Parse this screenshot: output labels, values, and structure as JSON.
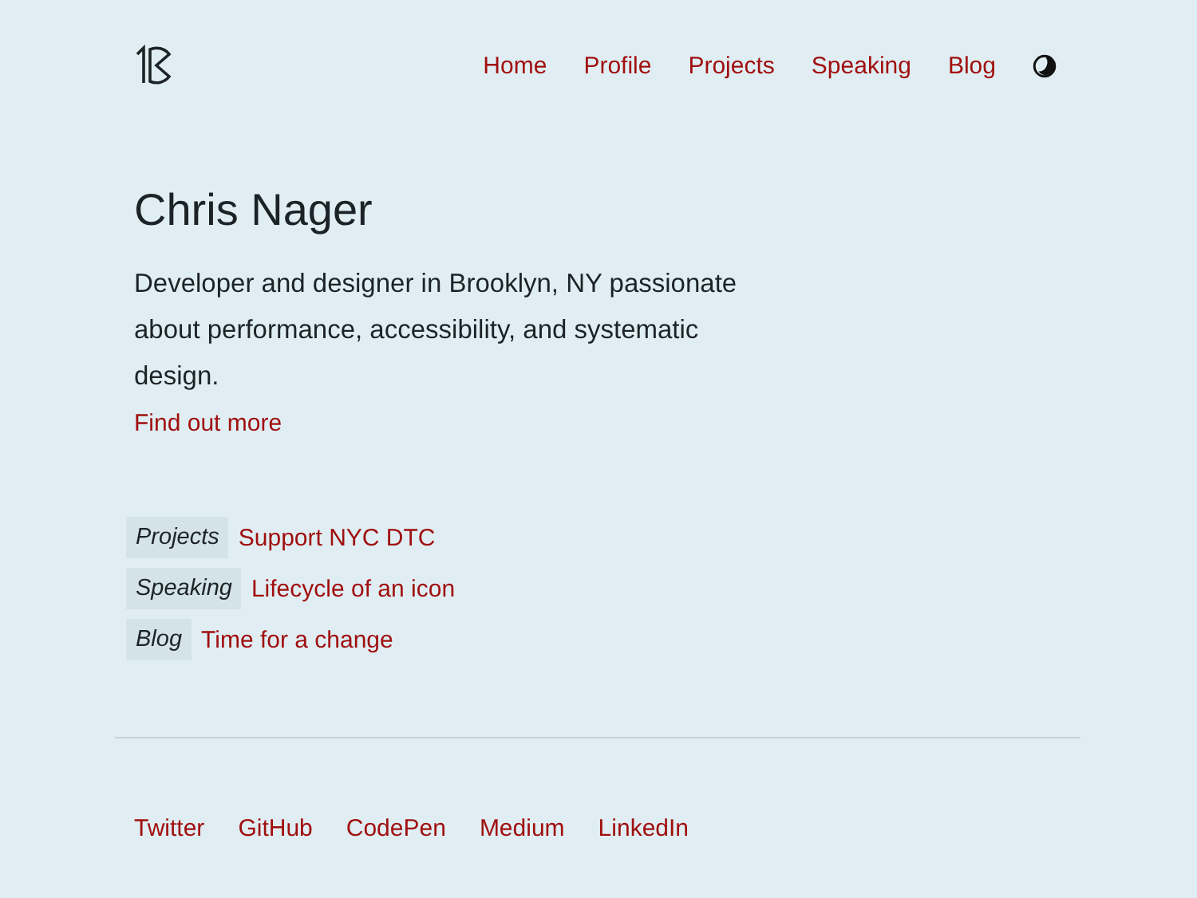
{
  "nav": {
    "links": [
      {
        "label": "Home"
      },
      {
        "label": "Profile"
      },
      {
        "label": "Projects"
      },
      {
        "label": "Speaking"
      },
      {
        "label": "Blog"
      }
    ]
  },
  "hero": {
    "title": "Chris Nager",
    "description": "Developer and designer in Brooklyn, NY passionate about performance, accessibility, and systematic design.",
    "link": "Find out more"
  },
  "recent": [
    {
      "category": "Projects",
      "title": "Support NYC DTC"
    },
    {
      "category": "Speaking",
      "title": "Lifecycle of an icon"
    },
    {
      "category": "Blog",
      "title": "Time for a change"
    }
  ],
  "footer": {
    "links": [
      {
        "label": "Twitter"
      },
      {
        "label": "GitHub"
      },
      {
        "label": "CodePen"
      },
      {
        "label": "Medium"
      },
      {
        "label": "LinkedIn"
      }
    ]
  }
}
